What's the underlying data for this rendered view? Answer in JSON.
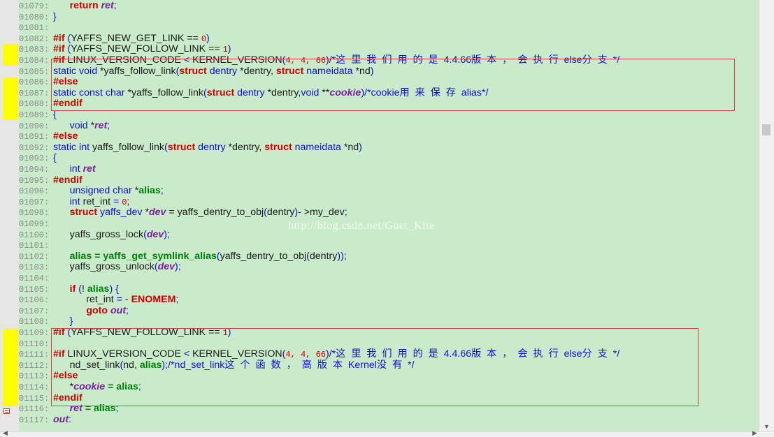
{
  "editor": {
    "watermark": "http://blog.csdn.net/Guet_Kite",
    "highlight_color": "#ffff00",
    "background_color": "#c9ebc9",
    "box_color": "#d94040",
    "lines": [
      {
        "no": "01079:",
        "tokens": [
          [
            "ws",
            "      "
          ],
          [
            "k",
            "return "
          ],
          [
            "v",
            "ret"
          ],
          [
            "p",
            ";"
          ]
        ]
      },
      {
        "no": "01080:",
        "tokens": [
          [
            "p",
            "}"
          ]
        ]
      },
      {
        "no": "01081:",
        "tokens": []
      },
      {
        "no": "01082:",
        "tokens": [
          [
            "k",
            "#if "
          ],
          [
            "p",
            "("
          ],
          [
            "d",
            "YAFFS_NEW_GET_LINK == "
          ],
          [
            "n",
            "0"
          ],
          [
            "p",
            ")"
          ]
        ]
      },
      {
        "no": "01083:",
        "tokens": [
          [
            "k",
            "#if "
          ],
          [
            "p",
            "("
          ],
          [
            "d",
            "YAFFS_NEW_FOLLOW_LINK == "
          ],
          [
            "n",
            "1"
          ],
          [
            "p",
            ")"
          ]
        ]
      },
      {
        "no": "01084:",
        "tokens": [
          [
            "k",
            "#if "
          ],
          [
            "d",
            "LINUX_VERSION_CODE "
          ],
          [
            "p",
            "< "
          ],
          [
            "d",
            "KERNEL_VERSION"
          ],
          [
            "p",
            "("
          ],
          [
            "n",
            "4, 4, 66"
          ],
          [
            "p",
            ")"
          ],
          [
            "c",
            "/*这  里  我  们  用  的  是  4.4.66版  本  ，  会  执  行  else分  支  */"
          ]
        ]
      },
      {
        "no": "01085:",
        "tokens": [
          [
            "p",
            "static void "
          ],
          [
            "f",
            "*yaffs_follow_link"
          ],
          [
            "p",
            "("
          ],
          [
            "k",
            "struct "
          ],
          [
            "p",
            "dentry "
          ],
          [
            "f",
            "*dentry, "
          ],
          [
            "k",
            "struct "
          ],
          [
            "p",
            "nameidata "
          ],
          [
            "f",
            "*nd"
          ],
          [
            "p",
            ")"
          ]
        ]
      },
      {
        "no": "01086:",
        "tokens": [
          [
            "k",
            "#else"
          ]
        ]
      },
      {
        "no": "01087:",
        "tokens": [
          [
            "p",
            "static const char "
          ],
          [
            "f",
            "*yaffs_follow_link"
          ],
          [
            "p",
            "("
          ],
          [
            "k",
            "struct "
          ],
          [
            "p",
            "dentry "
          ],
          [
            "f",
            "*dentry,"
          ],
          [
            "p",
            "void "
          ],
          [
            "f",
            "**"
          ],
          [
            "v",
            "cookie"
          ],
          [
            "p",
            ")"
          ],
          [
            "c",
            "/*cookie用  来  保  存  alias*/"
          ]
        ]
      },
      {
        "no": "01088:",
        "tokens": [
          [
            "k",
            "#endif"
          ]
        ]
      },
      {
        "no": "01089:",
        "tokens": [
          [
            "p",
            "{"
          ]
        ]
      },
      {
        "no": "01090:",
        "tokens": [
          [
            "ws",
            "      "
          ],
          [
            "p",
            "void "
          ],
          [
            "f",
            "*"
          ],
          [
            "v",
            "ret"
          ],
          [
            "p",
            ";"
          ]
        ]
      },
      {
        "no": "01091:",
        "tokens": [
          [
            "k",
            "#else"
          ]
        ]
      },
      {
        "no": "01092:",
        "tokens": [
          [
            "p",
            "static int "
          ],
          [
            "f",
            "yaffs_follow_link"
          ],
          [
            "p",
            "("
          ],
          [
            "k",
            "struct "
          ],
          [
            "p",
            "dentry "
          ],
          [
            "f",
            "*dentry, "
          ],
          [
            "k",
            "struct "
          ],
          [
            "p",
            "nameidata "
          ],
          [
            "f",
            "*nd"
          ],
          [
            "p",
            ")"
          ]
        ]
      },
      {
        "no": "01093:",
        "tokens": [
          [
            "p",
            "{"
          ]
        ]
      },
      {
        "no": "01094:",
        "tokens": [
          [
            "ws",
            "      "
          ],
          [
            "p",
            "int "
          ],
          [
            "v",
            "ret"
          ]
        ]
      },
      {
        "no": "01095:",
        "tokens": [
          [
            "k",
            "#endif"
          ]
        ]
      },
      {
        "no": "01096:",
        "tokens": [
          [
            "ws",
            "      "
          ],
          [
            "p",
            "unsigned char "
          ],
          [
            "f",
            "*"
          ],
          [
            "gk",
            "alias"
          ],
          [
            "p",
            ";"
          ]
        ]
      },
      {
        "no": "01097:",
        "tokens": [
          [
            "ws",
            "      "
          ],
          [
            "p",
            "int "
          ],
          [
            "f",
            "ret_int "
          ],
          [
            "p",
            "= "
          ],
          [
            "n",
            "0"
          ],
          [
            "p",
            ";"
          ]
        ]
      },
      {
        "no": "01098:",
        "tokens": [
          [
            "ws",
            "      "
          ],
          [
            "k",
            "struct "
          ],
          [
            "p",
            "yaffs_dev "
          ],
          [
            "f",
            "*"
          ],
          [
            "v",
            "dev"
          ],
          [
            "f",
            " = yaffs_dentry_to_obj"
          ],
          [
            "p",
            "("
          ],
          [
            "f",
            "dentry"
          ],
          [
            "p",
            ")"
          ],
          [
            "f",
            "- >my_dev"
          ],
          [
            "p",
            ";"
          ]
        ]
      },
      {
        "no": "01099:",
        "tokens": []
      },
      {
        "no": "01100:",
        "tokens": [
          [
            "ws",
            "      "
          ],
          [
            "f",
            "yaffs_gross_lock"
          ],
          [
            "p",
            "("
          ],
          [
            "v",
            "dev"
          ],
          [
            "p",
            ")"
          ],
          [
            "p",
            ";"
          ]
        ]
      },
      {
        "no": "01101:",
        "tokens": []
      },
      {
        "no": "01102:",
        "tokens": [
          [
            "ws",
            "      "
          ],
          [
            "gk",
            "alias"
          ],
          [
            "fb",
            " = yaffs_get_symlink_alias"
          ],
          [
            "p",
            "("
          ],
          [
            "f",
            "yaffs_dentry_to_obj"
          ],
          [
            "p",
            "("
          ],
          [
            "f",
            "dentry"
          ],
          [
            "p",
            "))"
          ],
          [
            "p",
            ";"
          ]
        ]
      },
      {
        "no": "01103:",
        "tokens": [
          [
            "ws",
            "      "
          ],
          [
            "f",
            "yaffs_gross_unlock"
          ],
          [
            "p",
            "("
          ],
          [
            "v",
            "dev"
          ],
          [
            "p",
            ")"
          ],
          [
            "p",
            ";"
          ]
        ]
      },
      {
        "no": "01104:",
        "tokens": []
      },
      {
        "no": "01105:",
        "tokens": [
          [
            "ws",
            "      "
          ],
          [
            "k",
            "if "
          ],
          [
            "p",
            "("
          ],
          [
            "f",
            "! "
          ],
          [
            "gk",
            "alias"
          ],
          [
            "p",
            ") {"
          ]
        ]
      },
      {
        "no": "01106:",
        "tokens": [
          [
            "ws",
            "            "
          ],
          [
            "f",
            "ret_int "
          ],
          [
            "p",
            "= "
          ],
          [
            "f",
            "- "
          ],
          [
            "k",
            "ENOMEM"
          ],
          [
            "p",
            ";"
          ]
        ]
      },
      {
        "no": "01107:",
        "tokens": [
          [
            "ws",
            "            "
          ],
          [
            "k",
            "goto "
          ],
          [
            "v",
            "out"
          ],
          [
            "p",
            ";"
          ]
        ]
      },
      {
        "no": "01108:",
        "tokens": [
          [
            "ws",
            "      "
          ],
          [
            "p",
            "}"
          ]
        ]
      },
      {
        "no": "01109:",
        "tokens": [
          [
            "k",
            "#if "
          ],
          [
            "p",
            "("
          ],
          [
            "d",
            "YAFFS_NEW_FOLLOW_LINK == "
          ],
          [
            "n",
            "1"
          ],
          [
            "p",
            ")"
          ]
        ]
      },
      {
        "no": "01110:",
        "tokens": []
      },
      {
        "no": "01111:",
        "tokens": [
          [
            "k",
            "#if "
          ],
          [
            "d",
            "LINUX_VERSION_CODE "
          ],
          [
            "p",
            "< "
          ],
          [
            "d",
            "KERNEL_VERSION"
          ],
          [
            "p",
            "("
          ],
          [
            "n",
            "4, 4, 66"
          ],
          [
            "p",
            ")"
          ],
          [
            "c",
            "/*这  里  我  们  用  的  是  4.4.66版  本  ，  会  执  行  else分  支  */"
          ]
        ]
      },
      {
        "no": "01112:",
        "tokens": [
          [
            "ws",
            "      "
          ],
          [
            "f",
            "nd_set_link"
          ],
          [
            "p",
            "("
          ],
          [
            "f",
            "nd, "
          ],
          [
            "gk",
            "alias"
          ],
          [
            "p",
            ")"
          ],
          [
            "p",
            ";"
          ],
          [
            "c",
            "/*nd_set_link这  个  函  数  ，  高  版  本  Kernel没  有  */"
          ]
        ]
      },
      {
        "no": "01113:",
        "tokens": [
          [
            "k",
            "#else"
          ]
        ]
      },
      {
        "no": "01114:",
        "tokens": [
          [
            "ws",
            "      "
          ],
          [
            "f",
            "*"
          ],
          [
            "v",
            "cookie"
          ],
          [
            "gk",
            " = alias"
          ],
          [
            "p",
            ";"
          ]
        ]
      },
      {
        "no": "01115:",
        "tokens": [
          [
            "k",
            "#endif"
          ]
        ]
      },
      {
        "no": "01116:",
        "tokens": [
          [
            "ws",
            "      "
          ],
          [
            "v",
            "ret"
          ],
          [
            "gk",
            " = alias"
          ],
          [
            "p",
            ";"
          ]
        ]
      },
      {
        "no": "01117:",
        "tokens": [
          [
            "v",
            "out"
          ],
          [
            "p",
            ":"
          ]
        ]
      }
    ]
  }
}
